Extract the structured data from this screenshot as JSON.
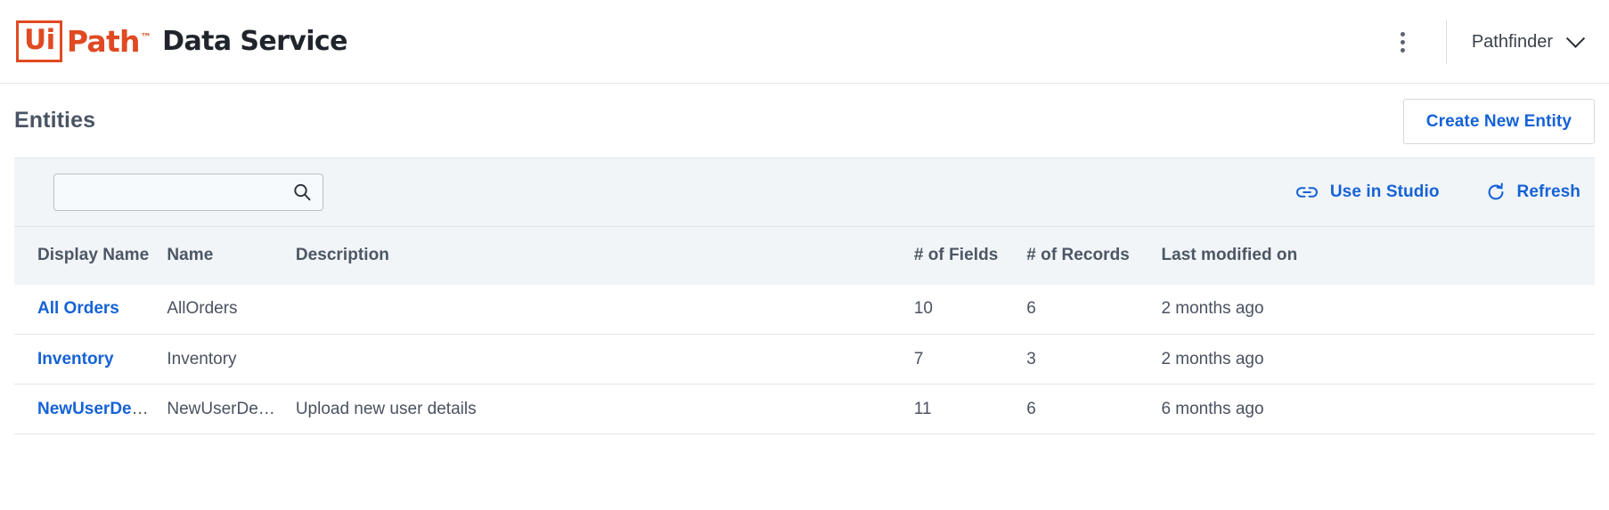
{
  "appbar": {
    "logo": {
      "mark_box": "Ui",
      "mark_word": "Path",
      "trademark": "™",
      "icon_name": "uipath-logo"
    },
    "product_title": "Data Service",
    "more_menu_label": "",
    "tenant": "Pathfinder",
    "colors": {
      "brand_orange": "#e04a22",
      "title_dark": "#20252c",
      "accent_blue": "#1562d6"
    }
  },
  "page": {
    "title": "Entities",
    "create_button": "Create New Entity"
  },
  "toolbar": {
    "search_value": "",
    "search_placeholder": "",
    "use_in_studio": "Use in Studio",
    "refresh": "Refresh"
  },
  "table": {
    "columns": [
      "Display Name",
      "Name",
      "Description",
      "# of Fields",
      "# of Records",
      "Last modified on"
    ],
    "rows": [
      {
        "display_name": "All Orders",
        "name": "AllOrders",
        "description": "",
        "fields": "10",
        "records": "6",
        "modified": "2 months ago"
      },
      {
        "display_name": "Inventory",
        "name": "Inventory",
        "description": "",
        "fields": "7",
        "records": "3",
        "modified": "2 months ago"
      },
      {
        "display_name": "NewUserDetails",
        "name": "NewUserDetails",
        "description": "Upload new user details",
        "fields": "11",
        "records": "6",
        "modified": "6 months ago"
      }
    ]
  }
}
